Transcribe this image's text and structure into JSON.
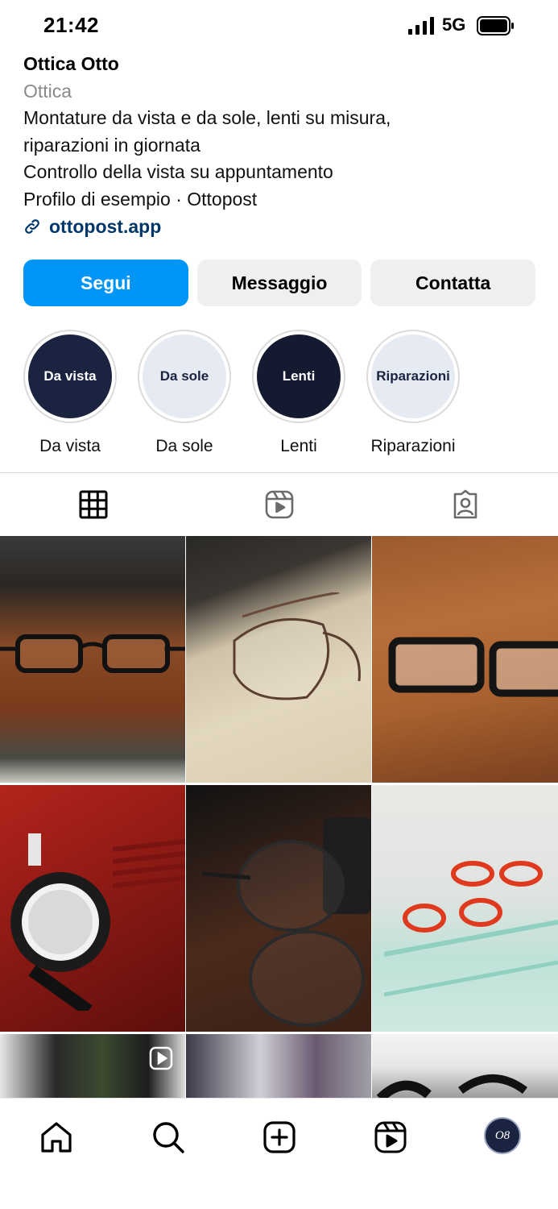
{
  "status_bar": {
    "time": "21:42",
    "network": "5G"
  },
  "profile": {
    "name": "Ottica Otto",
    "category": "Ottica",
    "bio": [
      "Montature da vista e da sole, lenti su misura,",
      "riparazioni in giornata",
      "Controllo della vista su appuntamento",
      "Profilo di esempio · Ottopost"
    ],
    "link": "ottopost.app"
  },
  "actions": {
    "follow": "Segui",
    "message": "Messaggio",
    "contact": "Contatta"
  },
  "highlights": [
    {
      "cover": "Da vista",
      "label": "Da vista"
    },
    {
      "cover": "Da sole",
      "label": "Da sole"
    },
    {
      "cover": "Lenti",
      "label": "Lenti"
    },
    {
      "cover": "Riparazioni",
      "label": "Riparazioni"
    }
  ],
  "tabs": [
    {
      "icon": "grid-icon",
      "active": true
    },
    {
      "icon": "reels-icon",
      "active": false
    },
    {
      "icon": "tagged-icon",
      "active": false
    }
  ],
  "grid": [
    {
      "subject": "black-rectangular-glasses",
      "reel": false
    },
    {
      "subject": "metal-frame-glasses-sunlight",
      "reel": false
    },
    {
      "subject": "black-frame-glasses-wood",
      "reel": false
    },
    {
      "subject": "trial-frame-red-case",
      "reel": false
    },
    {
      "subject": "round-glasses-dark-wood",
      "reel": false
    },
    {
      "subject": "red-glasses-glass-shelf",
      "reel": false
    },
    {
      "subject": "sunglasses-display",
      "reel": true
    },
    {
      "subject": "sunglasses-blur",
      "reel": false
    },
    {
      "subject": "black-frames-white",
      "reel": false
    }
  ],
  "avatar": {
    "monogram": "O8"
  },
  "colors": {
    "accent": "#0095f6",
    "link": "#00376b",
    "brand_dark": "#1a2440"
  }
}
